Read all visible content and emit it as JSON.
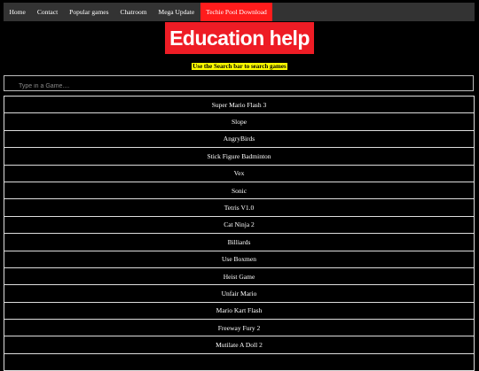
{
  "nav": {
    "items": [
      {
        "label": "Home",
        "active": false
      },
      {
        "label": "Contact",
        "active": false
      },
      {
        "label": "Popular games",
        "active": false
      },
      {
        "label": "Chatroom",
        "active": false
      },
      {
        "label": "Mega Update",
        "active": false
      },
      {
        "label": "Techie Pool Download",
        "active": true
      }
    ]
  },
  "logo": {
    "text": "Education help"
  },
  "hint": {
    "text": "Use the Search bar to search games"
  },
  "search": {
    "placeholder": "Type in a Game...."
  },
  "games": [
    {
      "label": "Super Mario Flash 3"
    },
    {
      "label": "Slope"
    },
    {
      "label": "AngryBirds"
    },
    {
      "label": "Stick Figure Badminton"
    },
    {
      "label": "Vex"
    },
    {
      "label": "Sonic"
    },
    {
      "label": "Tetris V1.0"
    },
    {
      "label": "Cat Ninja 2"
    },
    {
      "label": "Billiards"
    },
    {
      "label": "Use Boxmen"
    },
    {
      "label": "Heist Game"
    },
    {
      "label": "Unfair Mario"
    },
    {
      "label": "Mario Kart Flash"
    },
    {
      "label": "Freeway Fury 2"
    },
    {
      "label": "Mutilate A Doll 2"
    },
    {
      "label": ""
    }
  ],
  "colors": {
    "background": "#000000",
    "nav_bar": "#333333",
    "nav_active": "#ff1c1c",
    "logo_bg": "#ee1c25",
    "hint_highlight": "#ffff00",
    "row_border": "#dddddd"
  }
}
